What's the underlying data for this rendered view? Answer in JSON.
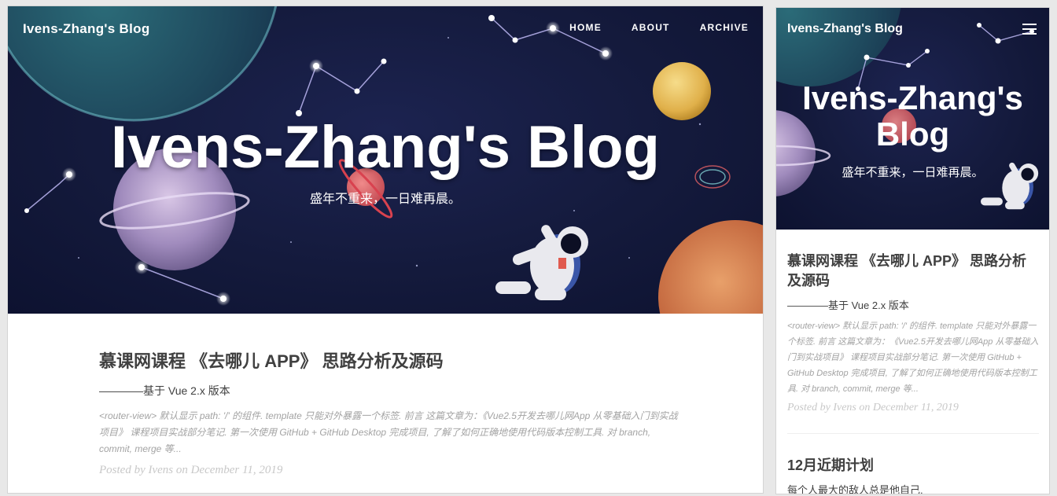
{
  "site": {
    "brand": "Ivens-Zhang's Blog",
    "nav": [
      "HOME",
      "ABOUT",
      "ARCHIVE"
    ]
  },
  "hero": {
    "title": "Ivens-Zhang's Blog",
    "subtitle": "盛年不重来，一日难再晨。"
  },
  "posts": [
    {
      "title": "慕课网课程 《去哪儿 APP》 思路分析及源码",
      "subtitle": "————基于 Vue 2.x 版本",
      "excerpt": "<router-view> 默认显示 path: '/' 的组件. template 只能对外暴露一个标签. 前言 这篇文章为：《Vue2.5开发去哪儿网App 从零基础入门到实战项目》 课程项目实战部分笔记. 第一次使用 GitHub + GitHub Desktop 完成项目, 了解了如何正确地使用代码版本控制工具. 对 branch, commit, merge 等...",
      "meta": "Posted by Ivens on December 11, 2019"
    },
    {
      "title": "12月近期计划",
      "subtitle": "每个人最大的敌人总是他自己."
    }
  ],
  "colors": {
    "hero_bg": "#141a3c",
    "text": "#404040",
    "muted": "#a3a3a3",
    "meta": "#c8c8c8"
  }
}
